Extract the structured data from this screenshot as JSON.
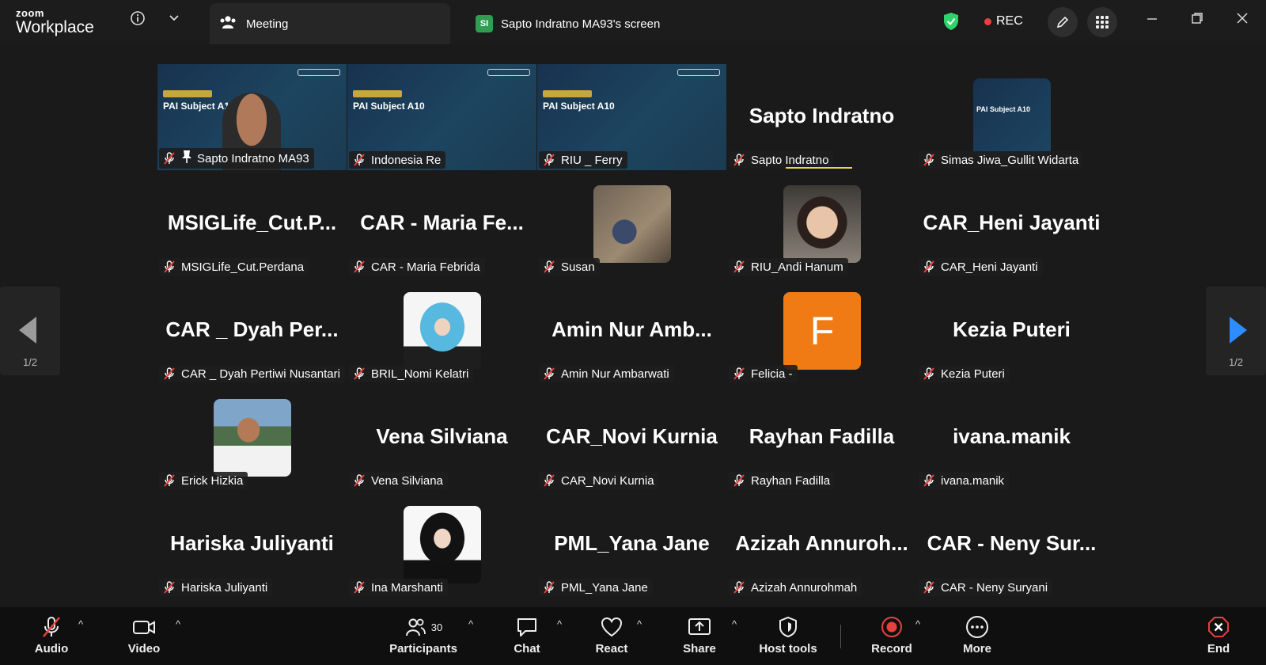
{
  "app": {
    "brand_small": "zoom",
    "brand_big": "Workplace"
  },
  "tabs": [
    {
      "label": "Meeting",
      "icon": "participants-icon"
    },
    {
      "label": "Sapto Indratno MA93's screen",
      "badge": "SI"
    }
  ],
  "status": {
    "rec_label": "REC",
    "secure_color": "#2dd46a",
    "rec_color": "#e8413d"
  },
  "slide": {
    "title": "PAI Subject A10"
  },
  "tiles": [
    {
      "name": "Sapto Indratno MA93",
      "kind": "video",
      "active": true
    },
    {
      "name": "Indonesia Re",
      "kind": "video"
    },
    {
      "name": "RIU _ Ferry",
      "kind": "video"
    },
    {
      "name": "Sapto Indratno",
      "kind": "text",
      "display": "Sapto Indratno"
    },
    {
      "name": "Simas Jiwa_Gullit Widarta",
      "kind": "avatar-slide"
    },
    {
      "name": "MSIGLife_Cut.Perdana",
      "kind": "text",
      "display": "MSIGLife_Cut.P..."
    },
    {
      "name": "CAR - Maria Febrida",
      "kind": "text",
      "display": "CAR - Maria Fe..."
    },
    {
      "name": "Susan",
      "kind": "avatar-photo"
    },
    {
      "name": "RIU_Andi Hanum",
      "kind": "avatar-photo"
    },
    {
      "name": "CAR_Heni Jayanti",
      "kind": "text",
      "display": "CAR_Heni Jayanti"
    },
    {
      "name": "CAR _ Dyah Pertiwi Nusantari",
      "kind": "text",
      "display": "CAR _ Dyah Per..."
    },
    {
      "name": "BRIL_Nomi Kelatri",
      "kind": "avatar-photo"
    },
    {
      "name": "Amin Nur Ambarwati",
      "kind": "text",
      "display": "Amin Nur Amb..."
    },
    {
      "name": "Felicia -",
      "kind": "avatar-letter",
      "letter": "F",
      "color": "#f07b14"
    },
    {
      "name": "Kezia Puteri",
      "kind": "text",
      "display": "Kezia Puteri"
    },
    {
      "name": "Erick Hizkia",
      "kind": "avatar-photo"
    },
    {
      "name": "Vena Silviana",
      "kind": "text",
      "display": "Vena Silviana"
    },
    {
      "name": "CAR_Novi Kurnia",
      "kind": "text",
      "display": "CAR_Novi Kurnia"
    },
    {
      "name": "Rayhan Fadilla",
      "kind": "text",
      "display": "Rayhan Fadilla"
    },
    {
      "name": "ivana.manik",
      "kind": "text",
      "display": "ivana.manik"
    },
    {
      "name": "Hariska Juliyanti",
      "kind": "text",
      "display": "Hariska Juliyanti"
    },
    {
      "name": "Ina Marshanti",
      "kind": "avatar-photo"
    },
    {
      "name": "PML_Yana Jane",
      "kind": "text",
      "display": "PML_Yana Jane"
    },
    {
      "name": "Azizah Annurohmah",
      "kind": "text",
      "display": "Azizah Annuroh..."
    },
    {
      "name": "CAR - Neny Suryani",
      "kind": "text",
      "display": "CAR - Neny Sur..."
    }
  ],
  "pager": {
    "left": "1/2",
    "right": "1/2"
  },
  "toolbar": {
    "audio": "Audio",
    "video": "Video",
    "participants": "Participants",
    "participant_count": "30",
    "chat": "Chat",
    "react": "React",
    "share": "Share",
    "host_tools": "Host tools",
    "record": "Record",
    "more": "More",
    "end": "End"
  }
}
